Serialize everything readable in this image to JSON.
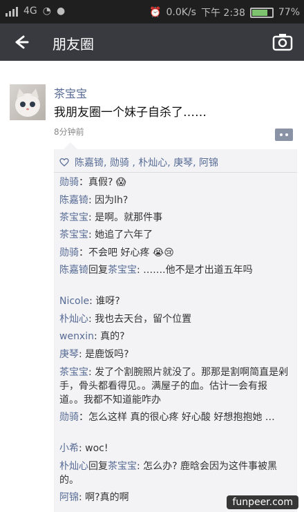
{
  "status_bar": {
    "network": "4G",
    "speed": "0.0K/s",
    "time": "下午 2:38",
    "battery": "77%"
  },
  "header": {
    "back_label": "←",
    "title": "朋友圈"
  },
  "post": {
    "author": "茶宝宝",
    "content": "我朋友圈一个妹子自杀了……",
    "time": "8分钟前",
    "likes_icon": "heart-outline-icon",
    "likes": "陈嘉锜, 勋骑 , 朴灿心, 庚琴, 阿锦",
    "comments": [
      {
        "name": "勋骑",
        "text": "：真假? 😱"
      },
      {
        "name": "陈嘉锜",
        "text": ": 因为lh?"
      },
      {
        "name": "茶宝宝",
        "text": ": 是啊。就那件事"
      },
      {
        "name": "茶宝宝",
        "text": ": 她追了六年了"
      },
      {
        "name": "勋骑",
        "text": "：不会吧 好心疼 😭😢"
      },
      {
        "name": "陈嘉锜",
        "reply_word": "回复",
        "reply_to": "茶宝宝",
        "text": ": …….他不是才出道五年吗"
      },
      {
        "name": "Nicole",
        "text": ": 谁呀?"
      },
      {
        "name": "朴灿心",
        "text": ": 我也去天台，留个位置"
      },
      {
        "name": "wenxin",
        "text": ": 真的?"
      },
      {
        "name": "庚琴",
        "text": ": 是鹿饭吗?"
      },
      {
        "name": "茶宝宝",
        "text": ": 发了个割腕照片就没了。那那是割啊简直是剁手，骨头都看得见。。满屋子的血。估计一会有报道。。我都不知道能咋办"
      },
      {
        "name": "勋骑",
        "text": "：怎么这样 真的很心疼 好心酸 好想抱抱她 …"
      },
      {
        "name": "小希",
        "text": ": woc!"
      },
      {
        "name": "朴灿心",
        "reply_word": "回复",
        "reply_to": "茶宝宝",
        "text": ": 怎么办? 鹿晗会因为这件事被黑的。"
      },
      {
        "name": "阿锦",
        "text": ": 啊?真的啊"
      }
    ]
  },
  "watermark": "funpeer.com"
}
